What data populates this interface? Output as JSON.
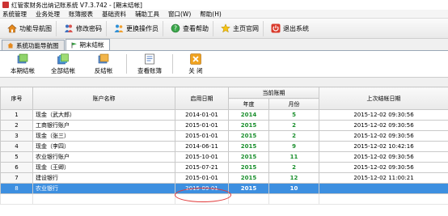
{
  "window": {
    "title": "红管家财务出纳记账系统 V7.3.742 - [期末结帐]"
  },
  "menu": [
    "系统管理",
    "业务处理",
    "账簿报表",
    "基础资料",
    "辅助工具",
    "窗口(W)",
    "帮助(H)"
  ],
  "toolbar": {
    "nav": "功能导航图",
    "password": "修改密码",
    "switch_user": "更换操作员",
    "help": "查看帮助",
    "website": "主页官网",
    "exit": "退出系统"
  },
  "tabs": [
    "系统功能导航图",
    "期末结帐"
  ],
  "functions": {
    "close_period": "本期结帐",
    "close_all": "全部结帐",
    "reverse": "反结帐",
    "view_ledger": "查看账簿",
    "close_window": "关 闭"
  },
  "grid": {
    "headers": {
      "index": "序号",
      "account": "账户名称",
      "start": "启用日期",
      "current_period": "当前账期",
      "year": "年度",
      "month": "月份",
      "last_close": "上次结帐日期"
    },
    "rows": [
      {
        "index": "1",
        "account": "现金（武大郎）",
        "start": "2014-01-01",
        "year": "2014",
        "month": "5",
        "last_close": "2015-12-02 09:30:56"
      },
      {
        "index": "2",
        "account": "工商银行账户",
        "start": "2015-01-01",
        "year": "2015",
        "month": "2",
        "last_close": "2015-12-02 09:30:56"
      },
      {
        "index": "3",
        "account": "现金（张三）",
        "start": "2015-01-01",
        "year": "2015",
        "month": "2",
        "last_close": "2015-12-02 09:30:56"
      },
      {
        "index": "4",
        "account": "现金（李四）",
        "start": "2014-06-11",
        "year": "2015",
        "month": "9",
        "last_close": "2015-12-02 10:42:16"
      },
      {
        "index": "5",
        "account": "农业银行账户",
        "start": "2015-10-01",
        "year": "2015",
        "month": "11",
        "last_close": "2015-12-02 09:30:56"
      },
      {
        "index": "6",
        "account": "现金（王卿）",
        "start": "2015-07-21",
        "year": "2015",
        "month": "2",
        "last_close": "2015-12-02 09:30:56"
      },
      {
        "index": "7",
        "account": "建设银行",
        "start": "2015-01-01",
        "year": "2015",
        "month": "12",
        "last_close": "2015-12-02 11:00:21"
      },
      {
        "index": "8",
        "account": "农业银行",
        "start": "2015-09-01",
        "year": "2015",
        "month": "10",
        "last_close": ""
      }
    ]
  }
}
